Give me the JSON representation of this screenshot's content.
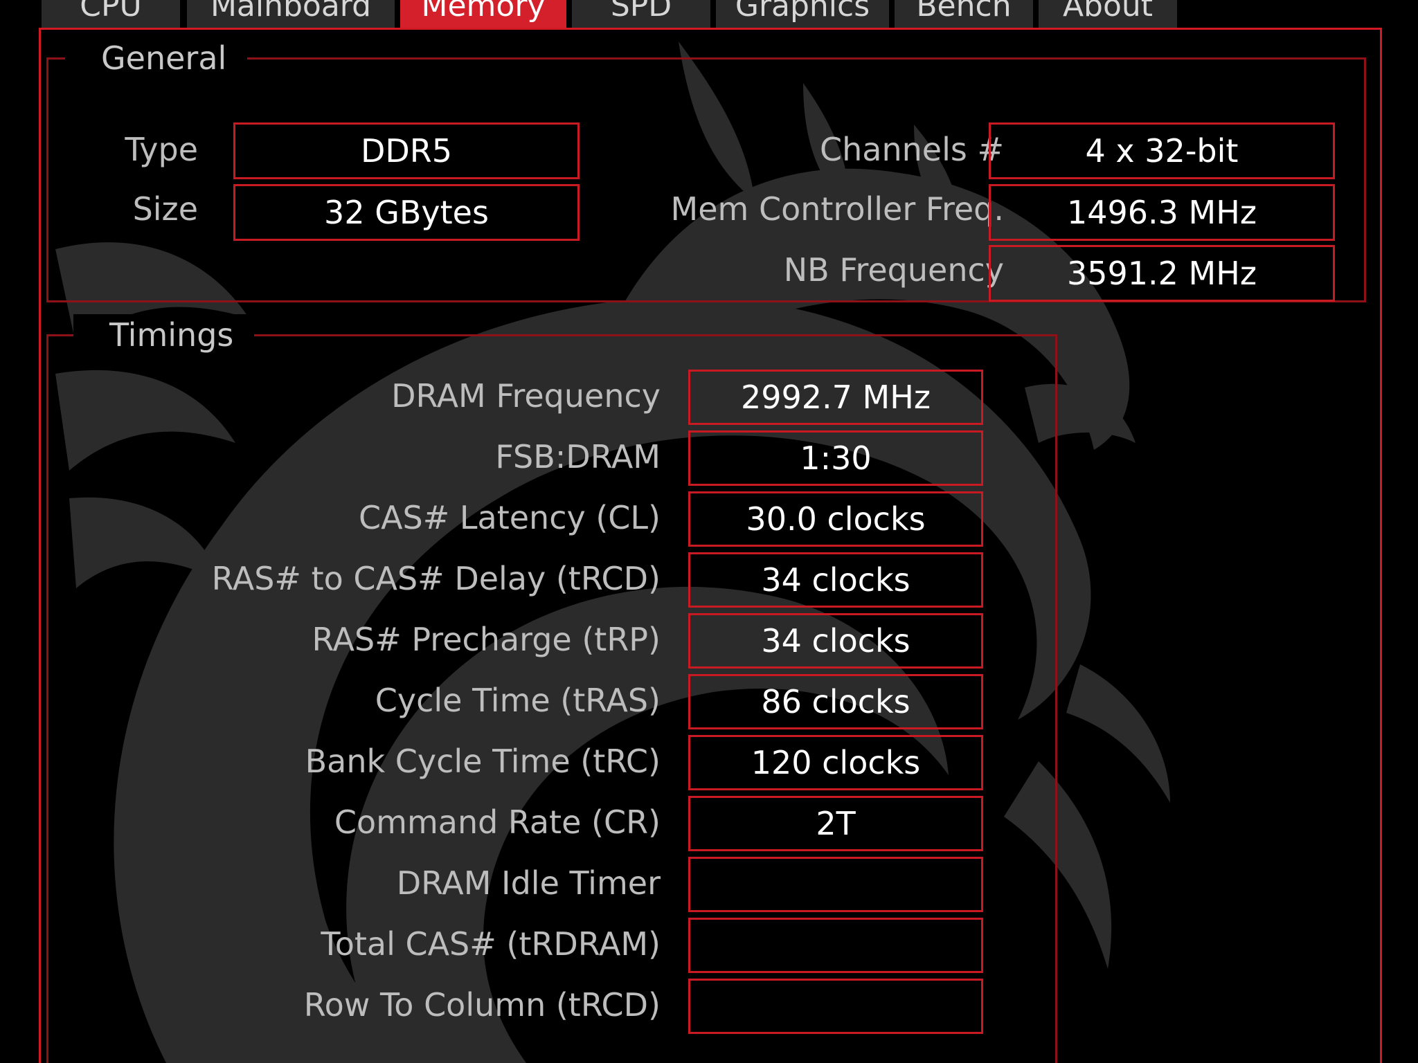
{
  "tabs": [
    {
      "label": "CPU"
    },
    {
      "label": "Mainboard"
    },
    {
      "label": "Memory"
    },
    {
      "label": "SPD"
    },
    {
      "label": "Graphics"
    },
    {
      "label": "Bench"
    },
    {
      "label": "About"
    }
  ],
  "active_tab": "Memory",
  "general": {
    "title": "General",
    "type_label": "Type",
    "type_value": "DDR5",
    "size_label": "Size",
    "size_value": "32 GBytes",
    "channels_label": "Channels #",
    "channels_value": "4 x 32-bit",
    "mem_ctrl_label": "Mem Controller Freq.",
    "mem_ctrl_value": "1496.3 MHz",
    "nb_label": "NB Frequency",
    "nb_value": "3591.2 MHz"
  },
  "timings": {
    "title": "Timings",
    "rows": [
      {
        "label": "DRAM Frequency",
        "value": "2992.7 MHz"
      },
      {
        "label": "FSB:DRAM",
        "value": "1:30"
      },
      {
        "label": "CAS# Latency (CL)",
        "value": "30.0 clocks"
      },
      {
        "label": "RAS# to CAS# Delay (tRCD)",
        "value": "34 clocks"
      },
      {
        "label": "RAS# Precharge (tRP)",
        "value": "34 clocks"
      },
      {
        "label": "Cycle Time (tRAS)",
        "value": "86 clocks"
      },
      {
        "label": "Bank Cycle Time (tRC)",
        "value": "120 clocks"
      },
      {
        "label": "Command Rate (CR)",
        "value": "2T"
      },
      {
        "label": "DRAM Idle Timer",
        "value": ""
      },
      {
        "label": "Total CAS# (tRDRAM)",
        "value": ""
      },
      {
        "label": "Row To Column (tRCD)",
        "value": ""
      }
    ]
  },
  "colors": {
    "accent": "#d4202a",
    "border": "#c81a22",
    "background": "#000000",
    "watermark": "#3a3a3a"
  },
  "icons": {
    "watermark": "dragon-logo-icon"
  }
}
